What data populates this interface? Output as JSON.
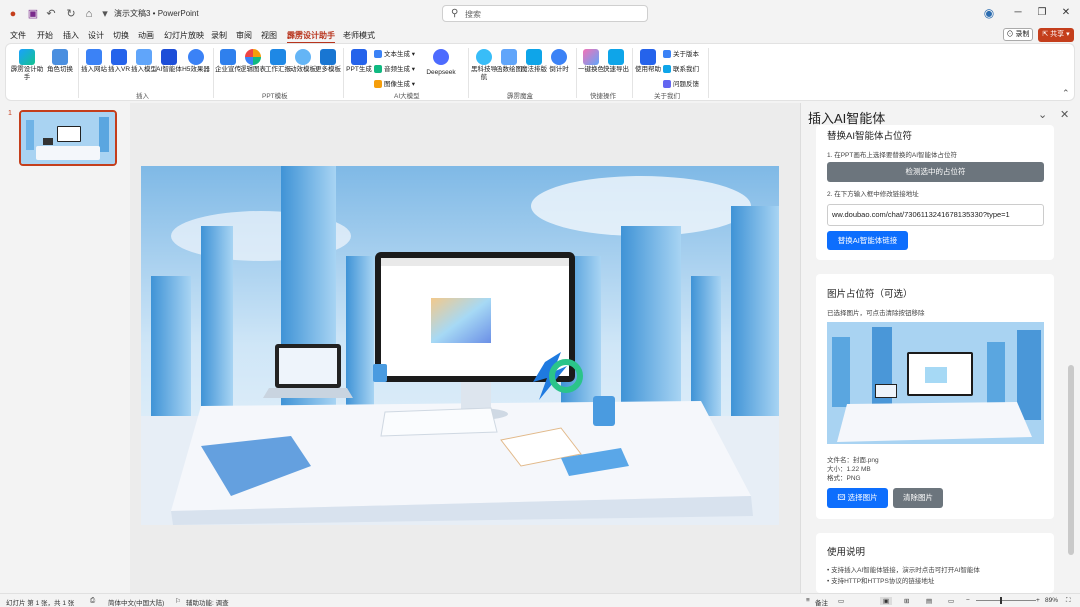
{
  "titlebar": {
    "doc_title": "演示文稿3 • PowerPoint",
    "search_placeholder": "搜索",
    "record_label": "⊙ 录制",
    "share_label": "⇱ 共享 ▾"
  },
  "menu_tabs": [
    "文件",
    "开始",
    "插入",
    "设计",
    "切换",
    "动画",
    "幻灯片放映",
    "录制",
    "审阅",
    "视图",
    "霹雳设计助手",
    "老师模式"
  ],
  "active_tab": "霹雳设计助手",
  "ribbon": {
    "insert_group": {
      "name": "插入",
      "buttons": [
        "霹雳设计助手",
        "角色切换",
        "插入网站",
        "插入VR",
        "插入模型",
        "AI智能体",
        "H5效果器"
      ]
    },
    "ppt_group": {
      "name": "PPT模板",
      "buttons": [
        "企业宣传",
        "逻辑图表",
        "工作汇报",
        "动效模板",
        "更多模板"
      ]
    },
    "ai_group": {
      "name": "AI大模型",
      "buttons": [
        "PPT生成",
        "Deepseek"
      ],
      "small": [
        "文本生成",
        "音频生成",
        "图像生成"
      ]
    },
    "magic_group": {
      "name": "霹雳魔盒",
      "buttons": [
        "黑科技导航",
        "函数绘图",
        "魔法排版",
        "倒计时"
      ]
    },
    "quick_group": {
      "name": "快捷操作",
      "buttons": [
        "一键换色",
        "快速导出"
      ]
    },
    "about_group": {
      "name": "关于我们",
      "buttons": [
        "使用帮助"
      ],
      "small": [
        "关于版本",
        "联系我们",
        "问题反馈"
      ]
    }
  },
  "slide_number": "1",
  "pane": {
    "title": "插入AI智能体",
    "replace_section": {
      "title": "替换AI智能体占位符",
      "step1": "1. 在PPT画布上选择要替换的AI智能体占位符",
      "detect_btn": "检测选中的占位符",
      "step2": "2. 在下方输入框中修改链接地址",
      "url_value": "ww.doubao.com/chat/7306113241678135330?type=1",
      "replace_btn": "替换AI智能体链接"
    },
    "image_section": {
      "title": "图片占位符（可选）",
      "hint": "已选择图片，可点击清除按钮移除",
      "file_name": "文件名：封面.png",
      "file_size": "大小：1.22 MB",
      "file_format": "格式：PNG",
      "select_btn": "🖾 选择图片",
      "clear_btn": "清除图片"
    },
    "usage_section": {
      "title": "使用说明",
      "items": [
        "• 支持插入AI智能体链接，演示时点击可打开AI智能体",
        "• 支持HTTP和HTTPS协议的链接地址"
      ]
    }
  },
  "statusbar": {
    "slide_info": "幻灯片 第 1 张，共 1 张",
    "language": "简体中文(中国大陆)",
    "accessibility": "辅助功能: 调查",
    "notes": "备注",
    "zoom": "89%"
  },
  "colors": {
    "accent": "#c43e1c",
    "primary_btn": "#0d6efd",
    "secondary_btn": "#6c757d"
  }
}
